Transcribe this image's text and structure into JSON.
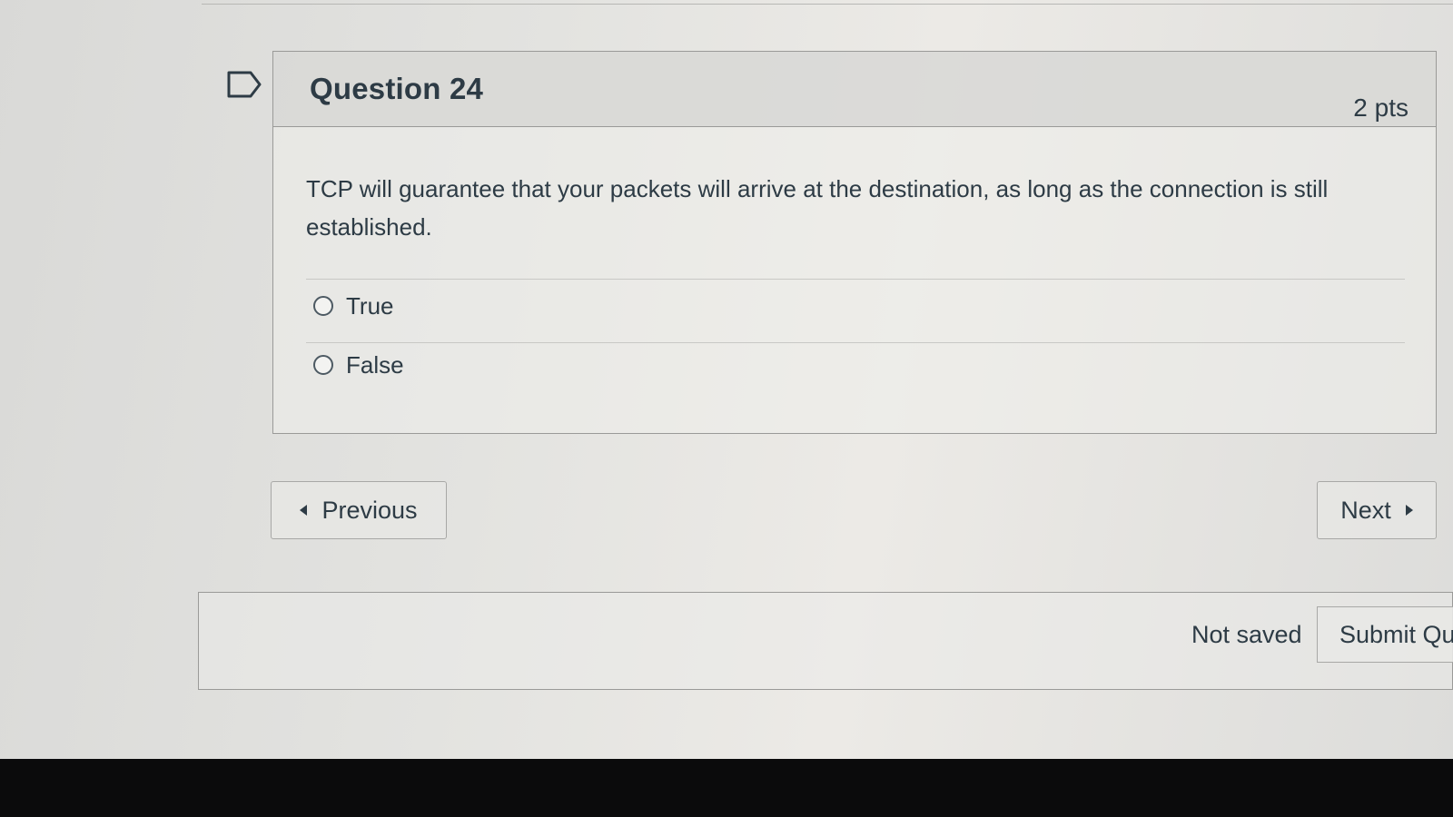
{
  "question": {
    "title": "Question 24",
    "points": "2 pts",
    "text": "TCP will guarantee that your packets will arrive at the destination, as long as the connection is still established.",
    "flag_icon": "bookmark-flag-icon",
    "answers": [
      {
        "label": "True",
        "selected": false
      },
      {
        "label": "False",
        "selected": false
      }
    ]
  },
  "navigation": {
    "previous_label": "Previous",
    "next_label": "Next"
  },
  "footer": {
    "status": "Not saved",
    "submit_label": "Submit Qui"
  }
}
